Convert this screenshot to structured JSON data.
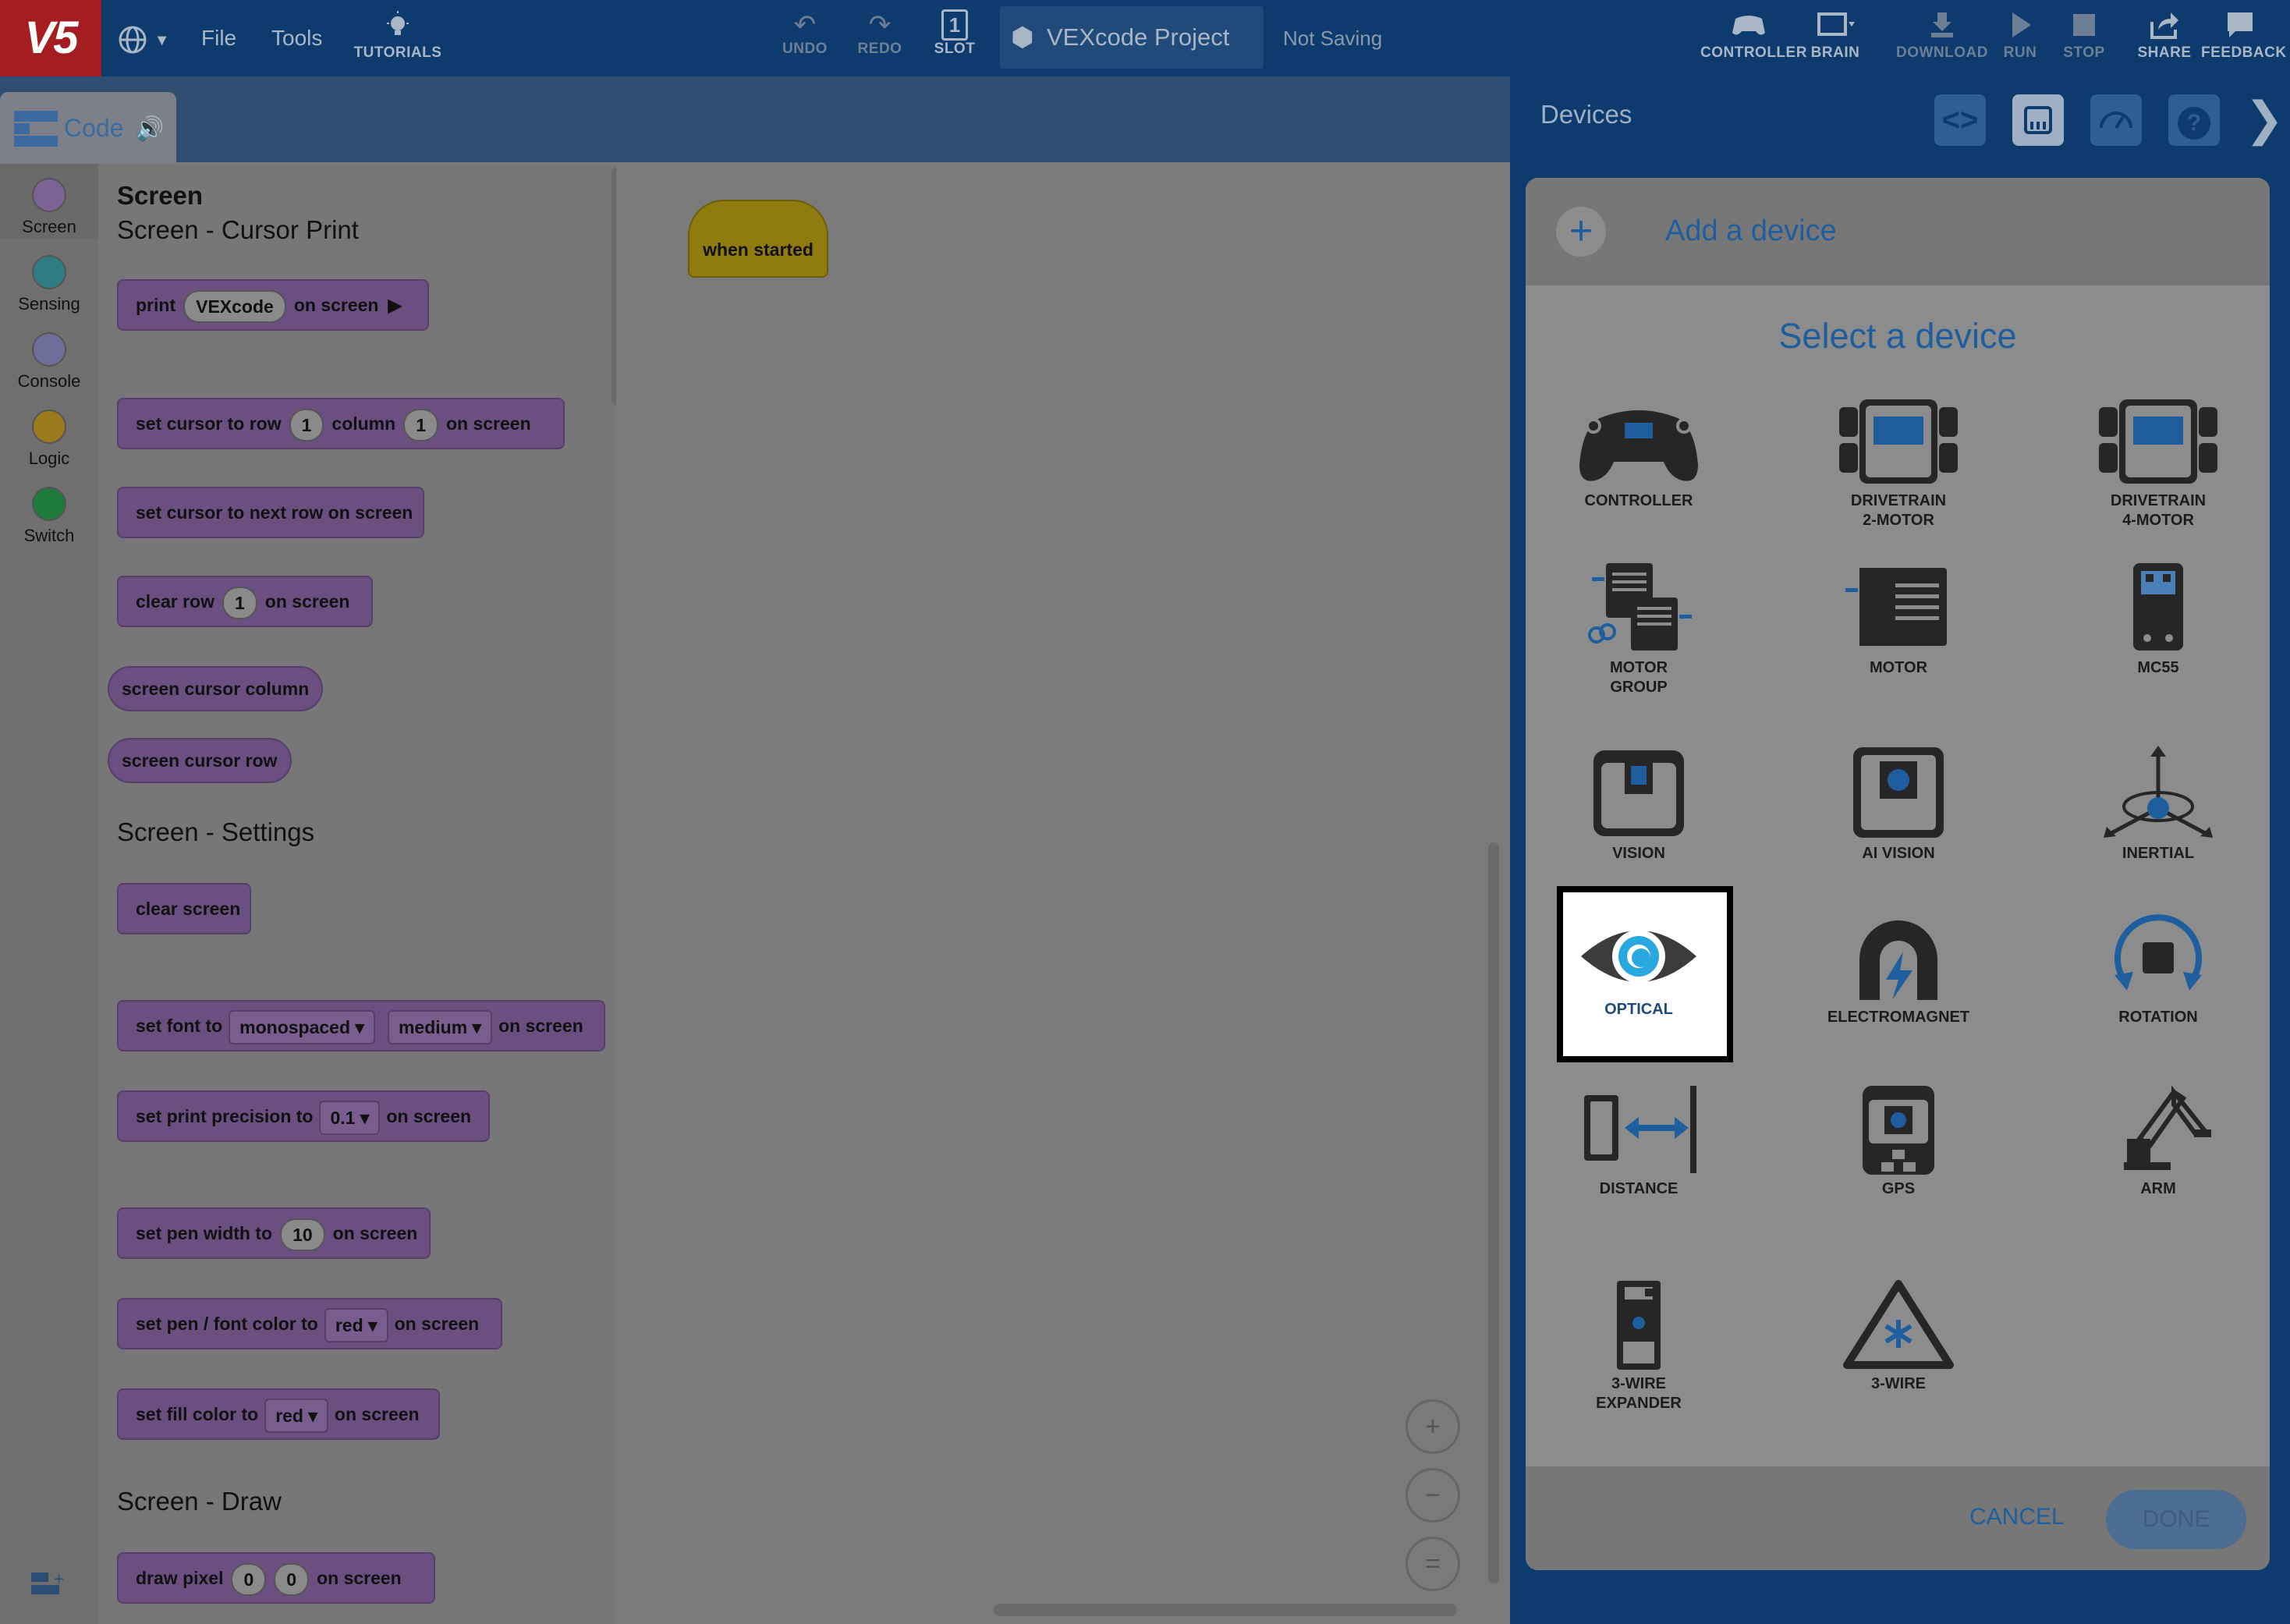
{
  "topbar": {
    "logo": "V5",
    "file": "File",
    "tools": "Tools",
    "tutorials": "TUTORIALS",
    "undo": "UNDO",
    "redo": "REDO",
    "slot": "SLOT",
    "slot_number": "1",
    "project_name": "VEXcode Project",
    "save_status": "Not Saving",
    "controller": "CONTROLLER",
    "brain": "BRAIN",
    "download": "DOWNLOAD",
    "run": "RUN",
    "stop": "STOP",
    "share": "SHARE",
    "feedback": "FEEDBACK"
  },
  "code_tab": {
    "label": "Code"
  },
  "categories": [
    {
      "label": "Screen",
      "color": "#7b6396"
    },
    {
      "label": "Sensing",
      "color": "#2f7c82"
    },
    {
      "label": "Console",
      "color": "#6e6e9a"
    },
    {
      "label": "Logic",
      "color": "#9a7a1a"
    },
    {
      "label": "Switch",
      "color": "#1f7a3e"
    }
  ],
  "palette": {
    "heading": "Screen",
    "sub_cursor": "Screen - Cursor Print",
    "sub_settings": "Screen - Settings",
    "sub_draw": "Screen - Draw",
    "b_print": {
      "a": "print",
      "v": "VEXcode",
      "b": "on screen"
    },
    "b_setcursor": {
      "a": "set cursor to row",
      "v1": "1",
      "b": "column",
      "v2": "1",
      "c": "on screen"
    },
    "b_nextrow": "set cursor to next row on screen",
    "b_clearrow": {
      "a": "clear row",
      "v": "1",
      "b": "on screen"
    },
    "b_col": "screen cursor column",
    "b_row": "screen cursor row",
    "b_clear": "clear screen",
    "b_font": {
      "a": "set font to",
      "v1": "monospaced",
      "v2": "medium",
      "b": "on screen"
    },
    "b_prec": {
      "a": "set print precision to",
      "v": "0.1",
      "b": "on screen"
    },
    "b_pen": {
      "a": "set pen width to",
      "v": "10",
      "b": "on screen"
    },
    "b_pencolor": {
      "a": "set pen / font color to",
      "v": "red",
      "b": "on screen"
    },
    "b_fill": {
      "a": "set fill color to",
      "v": "red",
      "b": "on screen"
    },
    "b_pixel": {
      "a": "draw pixel",
      "v1": "0",
      "v2": "0",
      "b": "on screen"
    }
  },
  "workspace": {
    "hat": "when started",
    "zoom_in": "+",
    "zoom_out": "−",
    "zoom_reset": "="
  },
  "devices": {
    "title": "Devices",
    "add": "Add a device",
    "select": "Select a device",
    "cancel": "CANCEL",
    "done": "DONE",
    "items": [
      {
        "l1": "CONTROLLER",
        "l2": ""
      },
      {
        "l1": "DRIVETRAIN",
        "l2": "2-MOTOR"
      },
      {
        "l1": "DRIVETRAIN",
        "l2": "4-MOTOR"
      },
      {
        "l1": "MOTOR",
        "l2": "GROUP"
      },
      {
        "l1": "MOTOR",
        "l2": ""
      },
      {
        "l1": "MC55",
        "l2": ""
      },
      {
        "l1": "VISION",
        "l2": ""
      },
      {
        "l1": "AI VISION",
        "l2": ""
      },
      {
        "l1": "INERTIAL",
        "l2": ""
      },
      {
        "l1": "OPTICAL",
        "l2": ""
      },
      {
        "l1": "ELECTROMAGNET",
        "l2": ""
      },
      {
        "l1": "ROTATION",
        "l2": ""
      },
      {
        "l1": "DISTANCE",
        "l2": ""
      },
      {
        "l1": "GPS",
        "l2": ""
      },
      {
        "l1": "ARM",
        "l2": ""
      },
      {
        "l1": "3-WIRE",
        "l2": "EXPANDER"
      },
      {
        "l1": "3-WIRE",
        "l2": ""
      }
    ]
  }
}
